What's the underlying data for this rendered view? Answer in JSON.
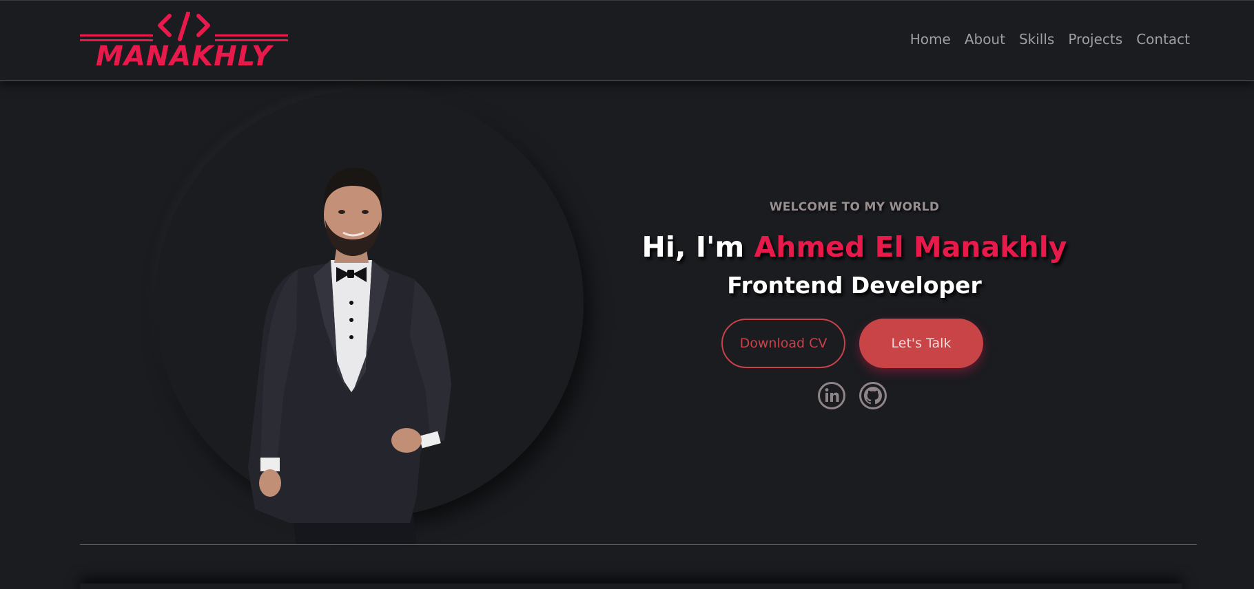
{
  "brand": {
    "logo_text": "MANAKHLY",
    "logo_symbol": "</>",
    "accent_color": "#e8194b"
  },
  "nav": {
    "items": [
      {
        "label": "Home"
      },
      {
        "label": "About"
      },
      {
        "label": "Skills"
      },
      {
        "label": "Projects"
      },
      {
        "label": "Contact"
      }
    ]
  },
  "hero": {
    "welcome": "WELCOME TO MY WORLD",
    "greeting": "Hi, I'm ",
    "name": "Ahmed El Manakhly",
    "role": "Frontend Developer",
    "buttons": {
      "download_cv": "Download CV",
      "lets_talk": "Let's Talk"
    },
    "socials": [
      {
        "icon": "linkedin-icon"
      },
      {
        "icon": "github-icon"
      }
    ]
  },
  "colors": {
    "background": "#1b1c20",
    "accent": "#e8194b",
    "button_red": "#c94447",
    "muted_text": "#9e9ea3"
  }
}
